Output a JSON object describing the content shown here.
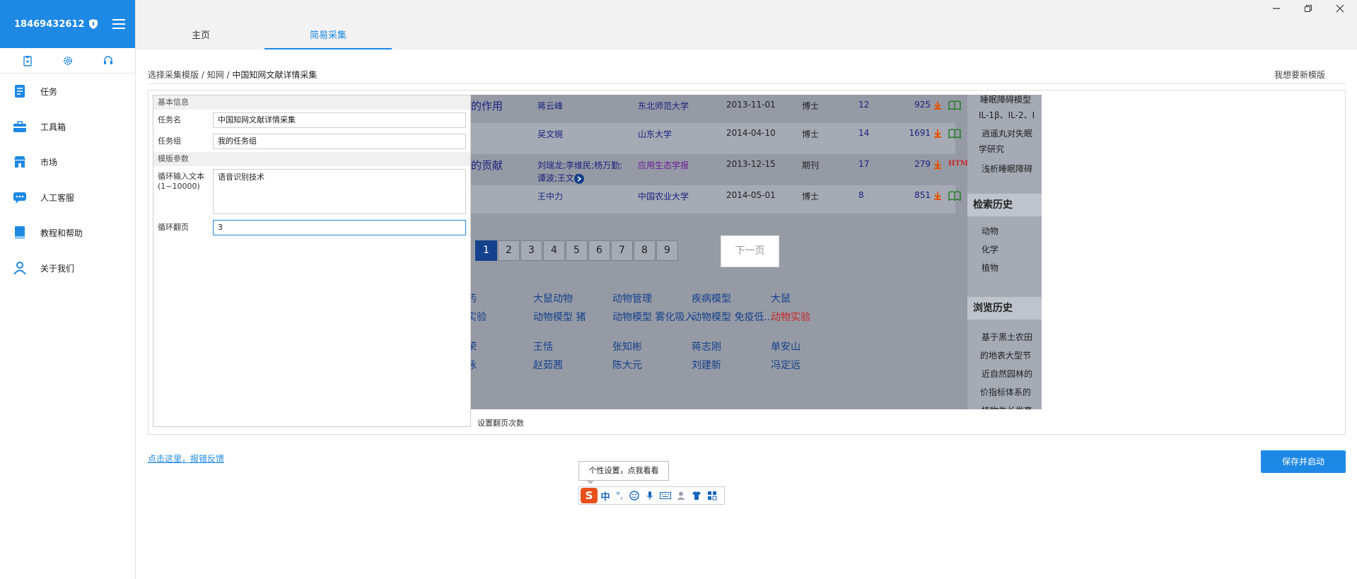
{
  "user": {
    "phone": "18469432612"
  },
  "nav": [
    {
      "label": "任务",
      "icon": "task-icon"
    },
    {
      "label": "工具箱",
      "icon": "toolbox-icon"
    },
    {
      "label": "市场",
      "icon": "market-icon"
    },
    {
      "label": "人工客服",
      "icon": "chat-icon"
    },
    {
      "label": "教程和帮助",
      "icon": "book-icon"
    },
    {
      "label": "关于我们",
      "icon": "person-icon"
    }
  ],
  "tabs": [
    {
      "label": "主页"
    },
    {
      "label": "简易采集"
    }
  ],
  "breadcrumb": {
    "a": "选择采集模版",
    "sep1": " / ",
    "b": "知网",
    "sep2": " / ",
    "c": "中国知网文献详情采集"
  },
  "new_template": "我想要新模版",
  "form": {
    "basic_section": "基本信息",
    "task_name_label": "任务名",
    "task_name_value": "中国知网文献详情采集",
    "task_group_label": "任务组",
    "task_group_value": "我的任务组",
    "params_section": "模版参数",
    "loop_text_label": "循环输入文本(1~10000)",
    "loop_text_value": "语音识别技术",
    "loop_page_label": "循环翻页",
    "loop_page_value": "3"
  },
  "preview": {
    "rows": [
      {
        "title": "的作用",
        "author": "蒋云峰",
        "source": "东北师范大学",
        "date": "2013-11-01",
        "type": "博士",
        "cite": "12",
        "dl": "925"
      },
      {
        "title": "",
        "author": "吴文婉",
        "source": "山东大学",
        "date": "2014-04-10",
        "type": "博士",
        "cite": "14",
        "dl": "1691"
      },
      {
        "title": "的贡献",
        "author": "刘瑞龙;李维民;杨万勤;",
        "author2": "谭波;王文君",
        "source": "应用生态学报",
        "date": "2013-12-15",
        "type": "期刊",
        "cite": "17",
        "dl": "279"
      },
      {
        "title": "",
        "author": "王中力",
        "source": "中国农业大学",
        "date": "2014-05-01",
        "type": "博士",
        "cite": "8",
        "dl": "851"
      }
    ],
    "html_tag": "HTML",
    "pages": [
      "1",
      "2",
      "3",
      "4",
      "5",
      "6",
      "7",
      "8",
      "9"
    ],
    "next_page": "下一页",
    "keywords_row1": [
      "药",
      "大鼠动物",
      "动物管理",
      "疾病模型",
      "大鼠"
    ],
    "keywords_row2": [
      "实验",
      "动物模型 猪",
      "动物模型 雾化吸入",
      "动物模型 免疫低...",
      "动物实验"
    ],
    "authors_row1": [
      "荣",
      "王恬",
      "张知彬",
      "蒋志刚",
      "单安山"
    ],
    "authors_row2": [
      "泳",
      "赵茹茜",
      "陈大元",
      "刘建新",
      "冯定远"
    ],
    "side_top": [
      "睡眠障碍模型",
      "IL-1β、IL-2、I",
      "逍遥丸对失眠",
      "学研究",
      "浅析睡眠障碍"
    ],
    "search_history_title": "检索历史",
    "search_history": [
      "动物",
      "化学",
      "植物"
    ],
    "browse_history_title": "浏览历史",
    "browse_history": [
      "基于黑土农田",
      "的地表大型节",
      "近自然园林的",
      "价指标体系的",
      "植物生长发育"
    ]
  },
  "hint": "设置翻页次数",
  "feedback": "点击这里，报错反馈",
  "save_button": "保存并启动",
  "tooltip": "个性设置，点我看看",
  "ime": {
    "logo": "S",
    "lang": "中",
    "punct": "°,"
  },
  "colors": {
    "accent": "#1e88e5",
    "preview_bg": "#969aa5"
  }
}
